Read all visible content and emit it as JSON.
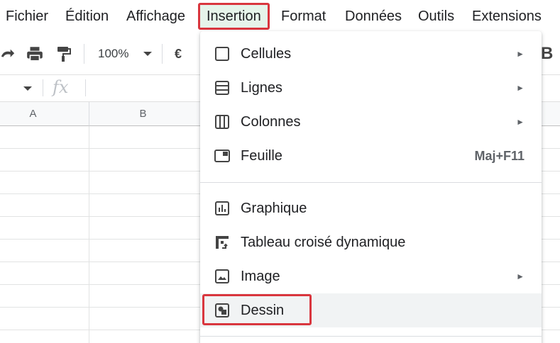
{
  "menubar": {
    "items": [
      "Fichier",
      "Édition",
      "Affichage",
      "Insertion",
      "Format",
      "Données",
      "Outils",
      "Extensions"
    ],
    "active": "Insertion"
  },
  "toolbar": {
    "zoom": "100%",
    "currency": "€",
    "bold_glyph": "B"
  },
  "formula_bar": {
    "fx_label": "fx"
  },
  "grid": {
    "columns": [
      "A",
      "B"
    ]
  },
  "menu": {
    "items": [
      {
        "label": "Cellules",
        "icon": "cells-icon",
        "submenu": true
      },
      {
        "label": "Lignes",
        "icon": "rows-icon",
        "submenu": true
      },
      {
        "label": "Colonnes",
        "icon": "columns-icon",
        "submenu": true
      },
      {
        "label": "Feuille",
        "icon": "sheet-icon",
        "shortcut": "Maj+F11"
      },
      {
        "label": "Graphique",
        "icon": "chart-icon"
      },
      {
        "label": "Tableau croisé dynamique",
        "icon": "pivot-table-icon"
      },
      {
        "label": "Image",
        "icon": "image-icon",
        "submenu": true
      },
      {
        "label": "Dessin",
        "icon": "drawing-icon",
        "highlighted": true
      }
    ],
    "submenu_arrow": "►"
  },
  "colors": {
    "highlight_border": "#d9363e",
    "active_menu_bg": "#e6f4ea",
    "hover_bg": "#f1f3f4"
  }
}
